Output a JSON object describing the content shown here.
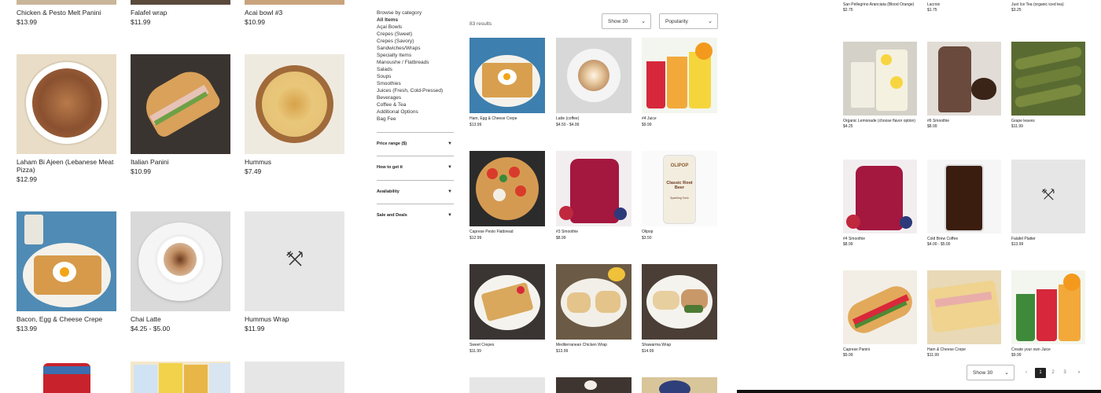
{
  "left_grid": {
    "top_row": [
      {
        "name": "Chicken  &  Pesto Melt Panini",
        "price": "$13.99"
      },
      {
        "name": "Falafel wrap",
        "price": "$11.99"
      },
      {
        "name": "Acai bowl #3",
        "price": "$10.99"
      }
    ],
    "row2": [
      {
        "name": "Laham Bi Ajeen (Lebanese Meat Pizza)",
        "price": "$12.99"
      },
      {
        "name": "Italian Panini",
        "price": "$10.99"
      },
      {
        "name": "Hummus",
        "price": "$7.49"
      }
    ],
    "row3": [
      {
        "name": "Bacon, Egg  &  Cheese Crepe",
        "price": "$13.99"
      },
      {
        "name": "Chai Latte",
        "price": "$4.25 - $5.00"
      },
      {
        "name": "Hummus Wrap",
        "price": "$11.99"
      }
    ]
  },
  "sidebar": {
    "heading": "Browse by category",
    "categories": [
      "All Items",
      "Açaí Bowls",
      "Crepes (Sweet)",
      "Crepes (Savory)",
      "Sandwiches/Wraps",
      "Specialty Items",
      "Manoushe / Flatbreads",
      "Salads",
      "Soups",
      "Smoothies",
      "Juices (Fresh, Cold-Pressed)",
      "Beverages",
      "Coffee  & Tea",
      "Additional Options",
      "Bag Fee"
    ],
    "filters": [
      "Price range ($)",
      "How to get it",
      "Availability",
      "Sale and Deals"
    ]
  },
  "results": {
    "count": "83 results",
    "show": "Show 30",
    "sort": "Popularity"
  },
  "mid_grid": [
    {
      "name": "Ham, Egg  &  Cheese Crepe",
      "price": "$13.99"
    },
    {
      "name": "Latte (coffee)",
      "price": "$4.50 - $4.99"
    },
    {
      "name": "#4 Juice",
      "price": "$9.99"
    },
    {
      "name": "Caprese Pesto Flatbread",
      "price": "$12.99"
    },
    {
      "name": "#3 Smoothie",
      "price": "$8.99"
    },
    {
      "name": "Olipop",
      "price": "$3.50"
    },
    {
      "name": "Sweet Crepes",
      "price": "$11.99"
    },
    {
      "name": "Mediterranean Chicken Wrap",
      "price": "$13.99"
    },
    {
      "name": "Shawarma Wrap",
      "price": "$14.99"
    }
  ],
  "right_panel": {
    "top_row": [
      {
        "name": "San Pellegrino Aranciata (Blood Orange)",
        "price": "$2.75"
      },
      {
        "name": "Lacroix",
        "price": "$1.75"
      },
      {
        "name": "Just Ice Tea (organic iced tea)",
        "price": "$3.25"
      }
    ],
    "grid": [
      {
        "name": "Organic Lemonade (choose flavor option)",
        "price": "$4.25"
      },
      {
        "name": "#6 Smoothie",
        "price": "$8.99"
      },
      {
        "name": "Grape leaves",
        "price": "$11.99"
      },
      {
        "name": "#4 Smoothie",
        "price": "$8.99"
      },
      {
        "name": "Cold Brew Coffee",
        "price": "$4.00 - $5.00"
      },
      {
        "name": "Falafel Platter",
        "price": "$13.99"
      },
      {
        "name": "Caprese Panini",
        "price": "$9.99"
      },
      {
        "name": "Ham  &  Cheese Crepe",
        "price": "$11.99"
      },
      {
        "name": "Create your own Juice",
        "price": "$9.99"
      }
    ],
    "show": "Show 30",
    "pages": [
      "1",
      "2",
      "3"
    ]
  },
  "olipop_can": {
    "brand": "OLIPOP",
    "flavor": "Classic Root Beer",
    "sub": "Sparkling Tonic"
  },
  "colors": {
    "accent": "#222222",
    "placeholder": "#e6e6e6"
  },
  "icons": [
    "utensils-icon",
    "chevron-down-icon",
    "caret-down-icon",
    "chevron-left-icon",
    "chevron-right-icon"
  ]
}
